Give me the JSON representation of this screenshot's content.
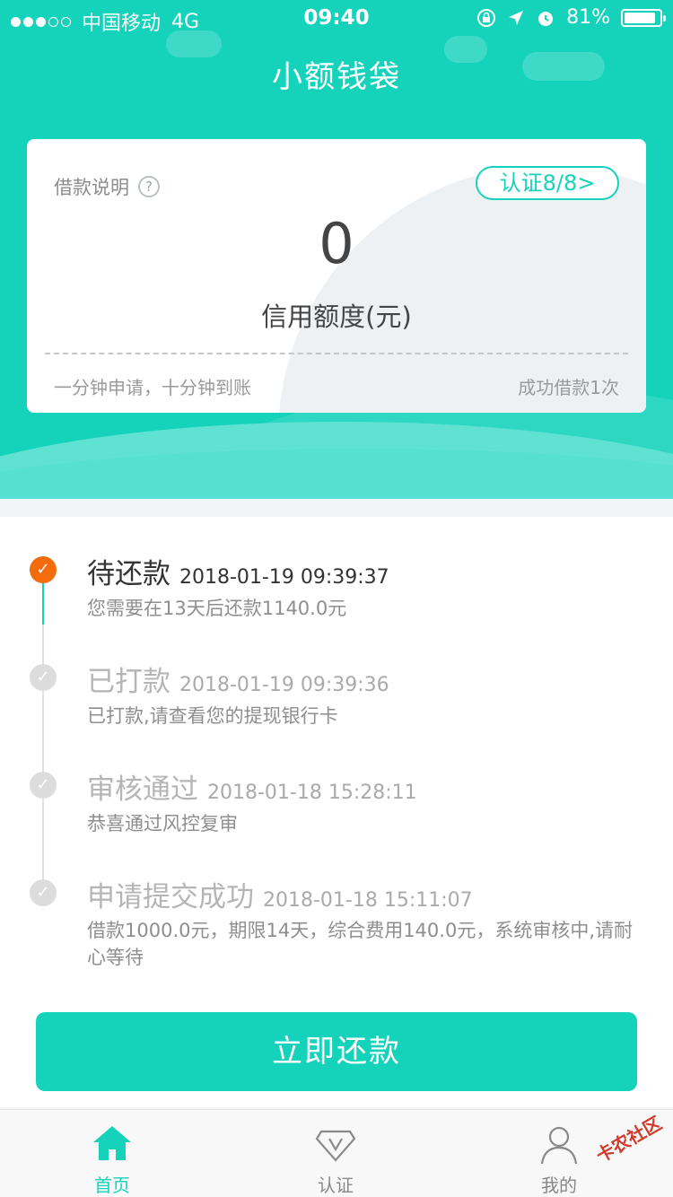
{
  "status_bar": {
    "carrier": "中国移动",
    "network": "4G",
    "time": "09:40",
    "battery": "81%",
    "battery_level": 0.81
  },
  "app": {
    "title": "小额钱袋"
  },
  "card": {
    "loan_info_label": "借款说明",
    "help_icon": "?",
    "cert_button": "认证8/8>",
    "amount": "0",
    "amount_label": "信用额度(元)",
    "slogan": "一分钟申请，十分钟到账",
    "success_count": "成功借款1次"
  },
  "timeline": [
    {
      "title": "待还款",
      "time": "2018-01-19 09:39:37",
      "desc": "您需要在13天后还款1140.0元",
      "active": true
    },
    {
      "title": "已打款",
      "time": "2018-01-19 09:39:36",
      "desc": "已打款,请查看您的提现银行卡",
      "active": false
    },
    {
      "title": "审核通过",
      "time": "2018-01-18 15:28:11",
      "desc": "恭喜通过风控复审",
      "active": false
    },
    {
      "title": "申请提交成功",
      "time": "2018-01-18 15:11:07",
      "desc": "借款1000.0元，期限14天，综合费用140.0元，系统审核中,请耐心等待",
      "active": false
    }
  ],
  "pay_button": "立即还款",
  "tabs": [
    {
      "label": "首页",
      "icon": "home-icon",
      "active": true
    },
    {
      "label": "认证",
      "icon": "verify-icon",
      "active": false
    },
    {
      "label": "我的",
      "icon": "user-icon",
      "active": false
    }
  ],
  "watermark": "卡农社区",
  "colors": {
    "accent": "#15d2bb",
    "active_dot": "#f26c0b"
  }
}
